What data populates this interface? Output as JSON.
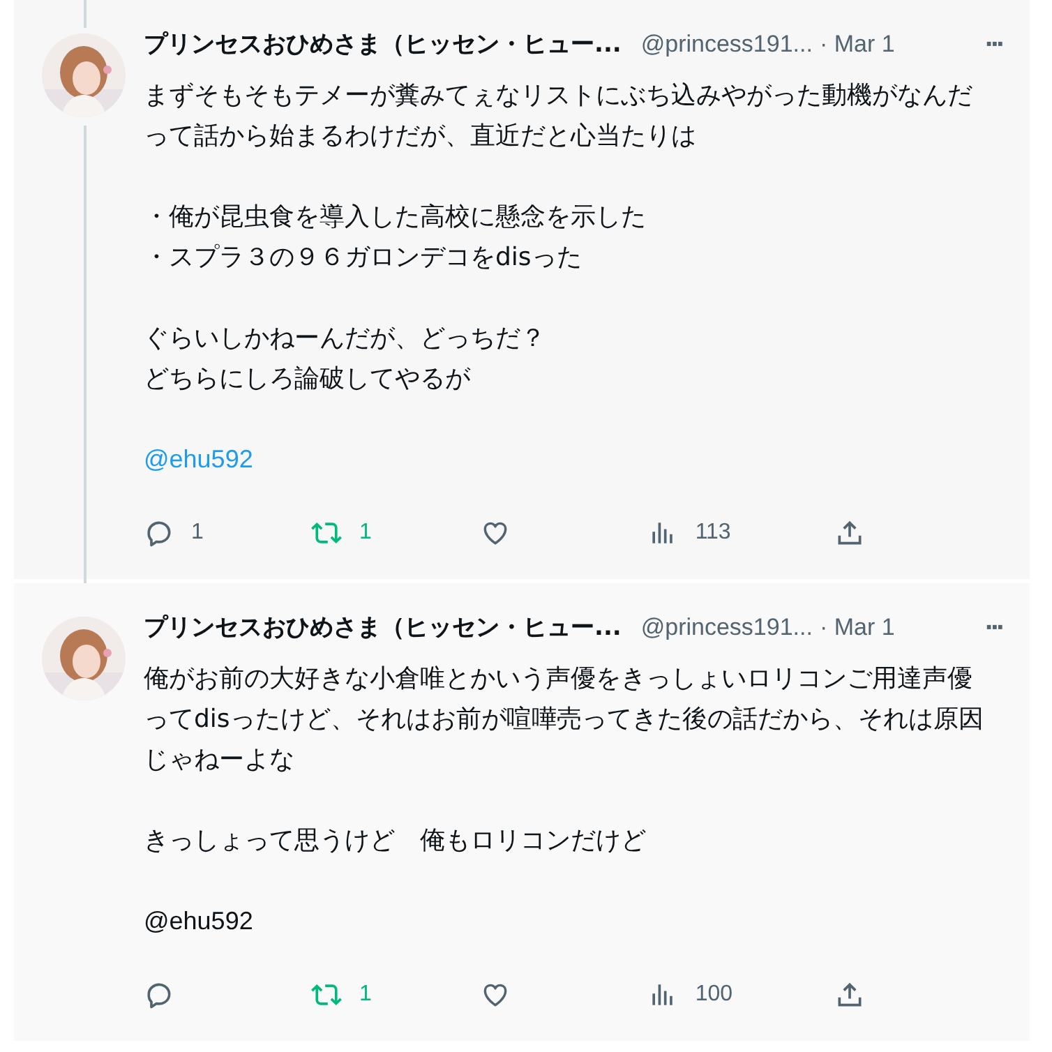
{
  "tweets": [
    {
      "name": "プリンセスおひめさま（ヒッセン・ヒュー...",
      "handle": "@princess191...",
      "date": "· Mar 1",
      "more": "···",
      "thread": true,
      "paragraphs": [
        [
          "まずそもそもテメーが糞みてぇなリストにぶち込みやがった動機がなんだって話から始まるわけだが、直近だと心当たりは"
        ],
        [
          "・俺が昆虫食を導入した高校に懸念を示した",
          "・スプラ３の９６ガロンデコをdisった"
        ],
        [
          "ぐらいしかねーんだが、どっちだ？",
          "どちらにしろ論破してやるが"
        ]
      ],
      "mention": {
        "text": "@ehu592",
        "linked": true
      },
      "reply_count": "1",
      "retweet_count": "1",
      "retweeted": true,
      "views": "113"
    },
    {
      "name": "プリンセスおひめさま（ヒッセン・ヒュー...",
      "handle": "@princess191...",
      "date": "· Mar 1",
      "more": "···",
      "thread": false,
      "paragraphs": [
        [
          "俺がお前の大好きな小倉唯とかいう声優をきっしょいロリコンご用達声優ってdisったけど、それはお前が喧嘩売ってきた後の話だから、それは原因じゃねーよな"
        ],
        [
          "きっしょって思うけど　俺もロリコンだけど"
        ]
      ],
      "mention": {
        "text": "@ehu592",
        "linked": false
      },
      "retweet_count": "1",
      "retweeted": true,
      "views": "100"
    }
  ]
}
